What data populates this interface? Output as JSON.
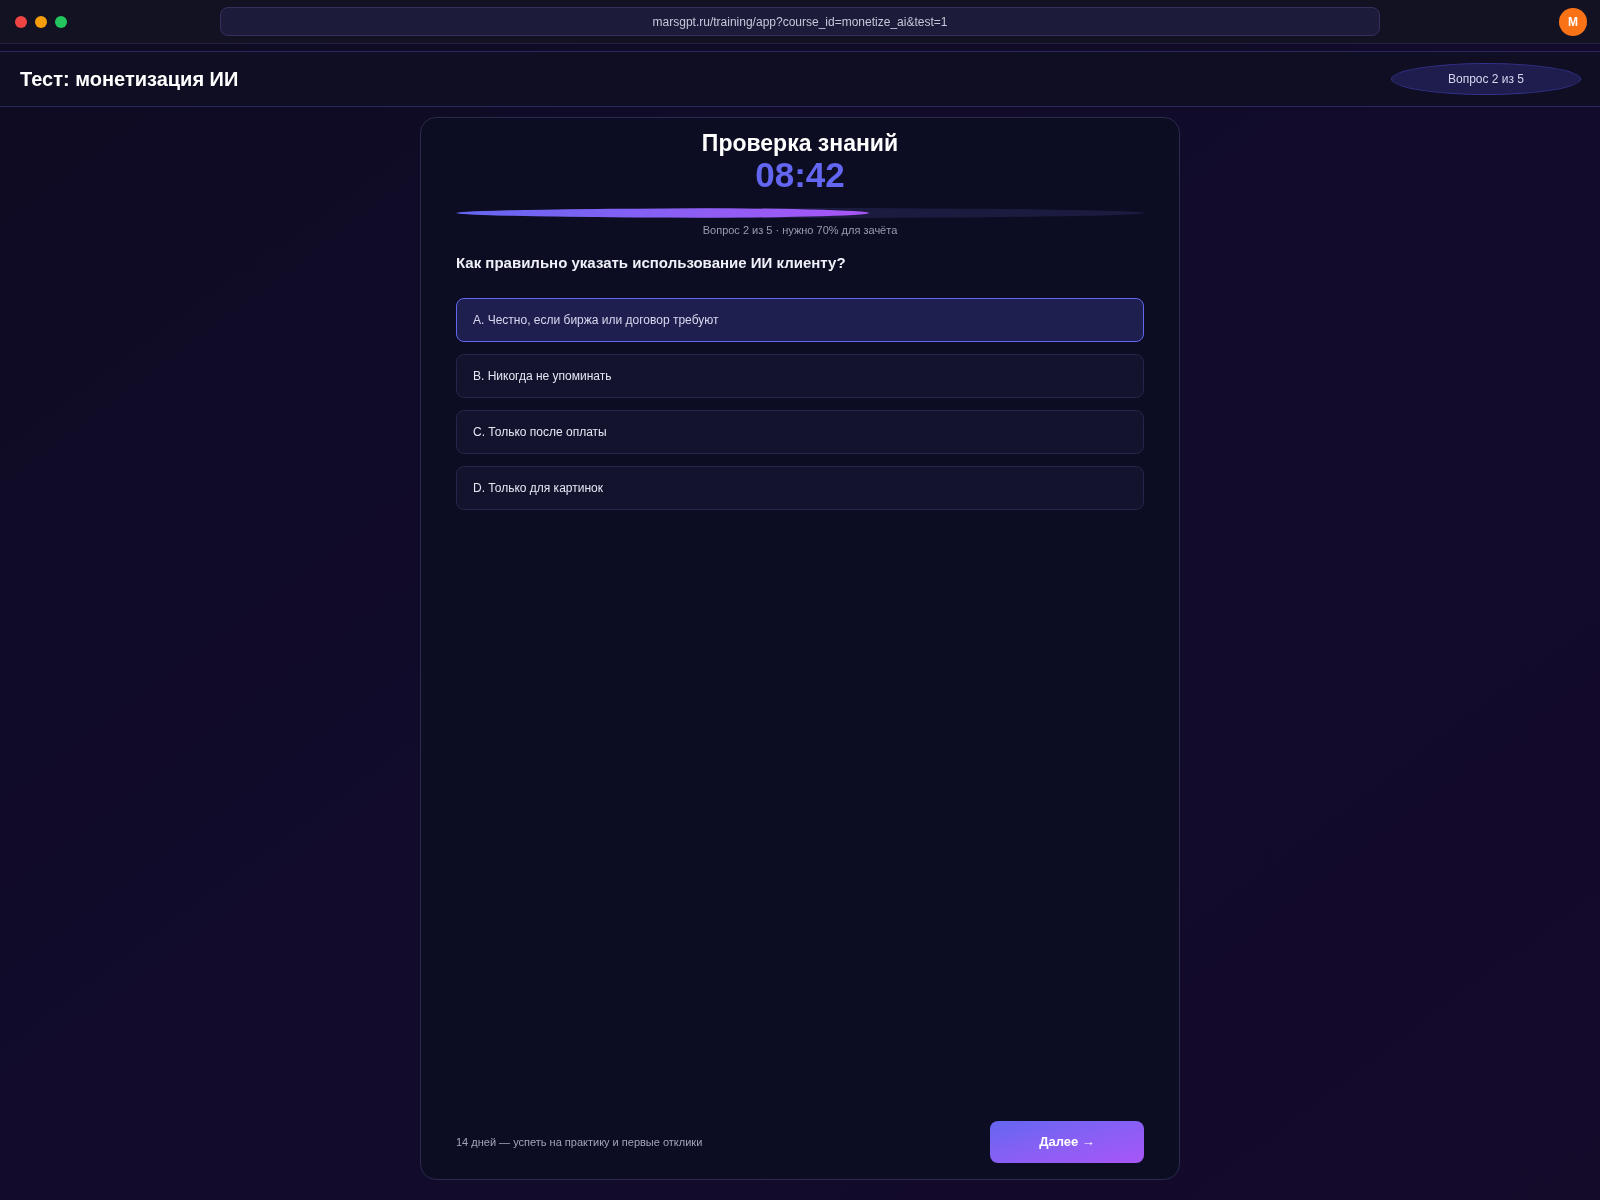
{
  "browser": {
    "url": "marsgpt.ru/training/app?course_id=monetize_ai&test=1",
    "avatar": "M"
  },
  "header": {
    "title": "Тест: монетизация ИИ",
    "badge": "Вопрос 2 из 5"
  },
  "quiz": {
    "title": "Проверка знаний",
    "timer": "08:42",
    "progress": {
      "level": 0.6
    },
    "caption": "Вопрос 2 из 5 · нужно 70% для зачёта",
    "question": "Как правильно указать использование ИИ клиенту?",
    "options": [
      {
        "label": "A. Честно, если биржа или договор требуют",
        "selected": true
      },
      {
        "label": "B. Никогда не упоминать",
        "selected": false
      },
      {
        "label": "C. Только после оплаты",
        "selected": false
      },
      {
        "label": "D. Только для картинок",
        "selected": false
      }
    ]
  },
  "footer": {
    "note": "14 дней — успеть на практику и первые отклики",
    "next_button": "Далее →"
  }
}
